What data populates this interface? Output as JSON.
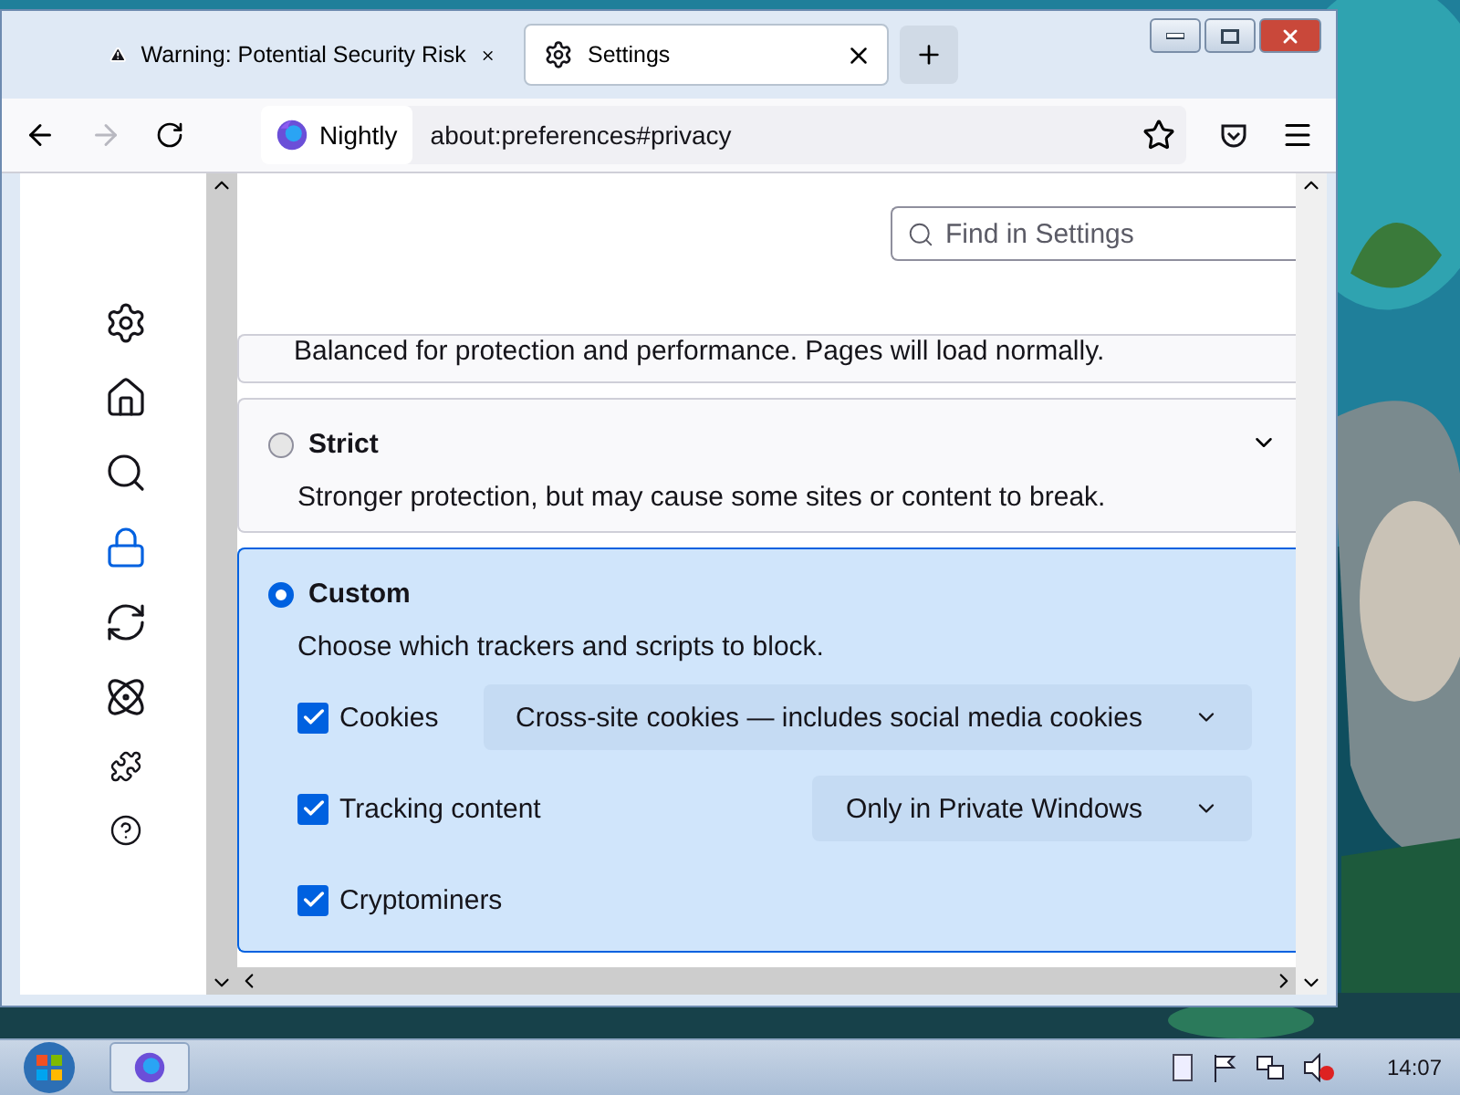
{
  "tabs": [
    {
      "kind": "warning",
      "label": "Warning: Potential Security Risk",
      "selected": false
    },
    {
      "kind": "settings",
      "label": "Settings",
      "selected": true
    }
  ],
  "navbar": {
    "browser_label": "Nightly",
    "url": "about:preferences#privacy",
    "forward_disabled": true
  },
  "search": {
    "placeholder": "Find in Settings"
  },
  "sidebar": {
    "items": [
      {
        "kind": "general",
        "selected": false
      },
      {
        "kind": "home",
        "selected": false
      },
      {
        "kind": "search",
        "selected": false
      },
      {
        "kind": "privacy",
        "selected": true
      },
      {
        "kind": "sync",
        "selected": false
      },
      {
        "kind": "experiments",
        "selected": false
      },
      {
        "kind": "extensions",
        "selected": false
      },
      {
        "kind": "help",
        "selected": false
      }
    ]
  },
  "protection_options": [
    {
      "kind": "partial",
      "description": "Balanced for protection and performance. Pages will load normally."
    },
    {
      "kind": "option",
      "title": "Strict",
      "description": "Stronger protection, but may cause some sites or content to break.",
      "selected": false,
      "expandable": true
    },
    {
      "kind": "option",
      "title": "Custom",
      "description": "Choose which trackers and scripts to block.",
      "selected": true,
      "expandable": false,
      "settings": [
        {
          "label": "Cookies",
          "checked": true,
          "dropdown": "Cross-site cookies — includes social media cookies"
        },
        {
          "label": "Tracking content",
          "checked": true,
          "dropdown": "Only in Private Windows"
        },
        {
          "label": "Cryptominers",
          "checked": true
        }
      ]
    }
  ],
  "taskbar": {
    "clock": "14:07"
  }
}
